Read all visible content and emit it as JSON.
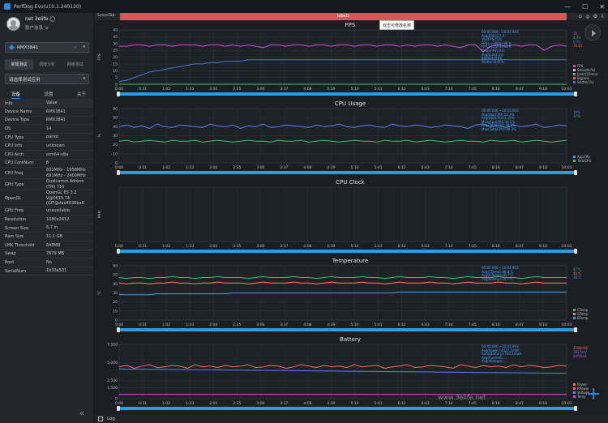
{
  "window": {
    "title": "PerfDog Evo(v10.1.240120)",
    "controls": [
      "—",
      "☐",
      "✕"
    ]
  },
  "user": {
    "name": "net 3elife ◯",
    "account": "账户信息 ⇲"
  },
  "device": {
    "name": "RMX3841",
    "wifi": "ᯤ",
    "dropdown": "▾"
  },
  "mode_tabs": [
    {
      "label": "常规测试",
      "active": true
    },
    {
      "label": "调度分析",
      "active": false
    },
    {
      "label": "网络测试",
      "active": false
    }
  ],
  "app_select": {
    "placeholder": "请选择测试应用",
    "dropdown": "▾"
  },
  "sub_tabs": [
    {
      "label": "设备",
      "active": true
    },
    {
      "label": "设置",
      "active": false
    },
    {
      "label": "关于",
      "active": false
    }
  ],
  "info_table": {
    "headers": [
      "Info",
      "Value"
    ],
    "rows": [
      [
        "Device Name",
        "RMX3841"
      ],
      [
        "Device Type",
        "RMX3841"
      ],
      [
        "OS",
        "14"
      ],
      [
        "CPU Type",
        "parrot"
      ],
      [
        "CPU Info",
        "unknown"
      ],
      [
        "CPU Arch",
        "arm64-v8a"
      ],
      [
        "CPU CoreNum",
        "8"
      ],
      [
        "CPU Freq",
        "691MHz - 1958MHz\n691MHz - 2400MHz"
      ],
      [
        "GPU Type",
        "Qualcomm Adreno\n(TM) 710"
      ],
      [
        "OpenGL",
        "OpenGL ES 3.2\nV@0615.74\n(GIT@dad4038ba6"
      ],
      [
        "GPU Freq",
        "unavailable"
      ],
      [
        "Resolution",
        "1080x2412"
      ],
      [
        "Screen Size",
        "6.7 in"
      ],
      [
        "Ram Size",
        "11.1 GB"
      ],
      [
        "LMK Threshold",
        "648MB"
      ],
      [
        "Swap",
        "7679 MB"
      ],
      [
        "Root",
        "No"
      ],
      [
        "SerialNum",
        "1b33e531"
      ]
    ]
  },
  "collapse_icon": "«",
  "topbar": {
    "scene_tab": "SceneTab",
    "label": "label1",
    "tooltip": "双击可修改名称",
    "icons": [
      "⊙",
      "◎",
      "⚙",
      "⇩"
    ]
  },
  "x_ticks": [
    "0:00",
    "0:31",
    "1:02",
    "1:33",
    "2:04",
    "2:35",
    "3:06",
    "3:37",
    "4:08",
    "4:39",
    "5:10",
    "5:41",
    "6:12",
    "6:43",
    "7:14",
    "7:45",
    "8:16",
    "8:47",
    "9:18",
    "10:03"
  ],
  "colors": {
    "fps": "#d14fd6",
    "fps_light": "#ff90ff",
    "jank": "#3fc46b",
    "jank_red": "#ff5a5a",
    "stutter": "#4a78c8",
    "appcpu": "#5f7df2",
    "totalcpu": "#3fc46b",
    "ctemp": "#3fc46b",
    "gtemp": "#ff7a59",
    "btemp": "#4a9be6",
    "power": "#ff6b5a",
    "voltage": "#5f7df2",
    "temp": "#d14fd6",
    "scroll": "#2a9de7",
    "grid": "#2e343b"
  },
  "chart_data": [
    {
      "type": "line",
      "title": "FPS",
      "ylabel": "FPS",
      "ylim": [
        0,
        40
      ],
      "yticks": [
        "0",
        "5",
        "10",
        "15",
        "20",
        "25",
        "30",
        "35",
        "40"
      ],
      "series": [
        {
          "name": "FPS",
          "values": [
            28,
            28,
            29,
            29,
            28,
            29,
            29,
            28,
            29,
            29,
            29,
            28,
            29,
            29,
            28,
            29,
            28,
            29,
            28,
            27,
            29,
            29,
            28,
            29,
            29,
            28,
            29,
            29,
            28,
            29,
            29,
            28,
            29,
            29,
            28,
            29,
            29,
            28,
            29,
            28,
            29,
            29,
            28,
            29,
            28,
            27,
            29,
            29,
            24,
            28,
            29,
            28,
            29,
            28,
            29,
            29,
            25,
            28,
            29,
            28
          ]
        },
        {
          "name": "Jank",
          "values": [
            0,
            0,
            0,
            0,
            0,
            0,
            0,
            0,
            0,
            0,
            0,
            0,
            0,
            0,
            0,
            0,
            0,
            0,
            0,
            0,
            0,
            0,
            0,
            0,
            0,
            0,
            0,
            0,
            0,
            0,
            0,
            0,
            0,
            0,
            0,
            0,
            0,
            0,
            0,
            0,
            0,
            0,
            0,
            0,
            0,
            0,
            0,
            0,
            0,
            0,
            0,
            0,
            0,
            0,
            0,
            0,
            0,
            0,
            0,
            0
          ]
        },
        {
          "name": "Stutter(%)",
          "values": [
            2,
            3,
            5,
            7,
            9,
            10,
            11,
            12,
            13,
            14,
            15,
            15,
            16,
            16,
            17,
            17,
            17,
            18,
            18,
            18,
            18,
            18,
            18,
            18,
            18,
            18,
            18,
            18,
            18,
            18,
            18,
            18,
            18,
            18,
            18,
            18,
            18,
            18,
            18,
            18,
            18,
            18,
            18,
            18,
            18,
            18,
            18,
            18,
            18,
            18,
            18,
            18,
            18,
            18,
            18,
            18,
            18,
            18,
            18,
            18
          ]
        }
      ],
      "legend": [
        "FPS",
        "Smooth(%)",
        "Jank(/10min)",
        "BigJank",
        "Stutter(%)"
      ],
      "right_values": [
        "30",
        "4.79",
        "0.00",
        "16.81"
      ],
      "info_box": "00:00:000 ~10:01:903\nAvg(FPS):27.2\nVar(FPS):5.0\nFPS>=18(%):98.9\nFPS>=25(%):91.9\nDrop(FPS):0.0\nAvg(Jank):4.8\nBigJank:0.00\nStutter:8.41%"
    },
    {
      "type": "line",
      "title": "CPU Usage",
      "ylabel": "%",
      "ylim": [
        0,
        60
      ],
      "yticks": [
        "0",
        "10",
        "20",
        "30",
        "40",
        "50",
        "60"
      ],
      "series": [
        {
          "name": "AppCPU",
          "values": [
            40,
            42,
            39,
            41,
            38,
            43,
            40,
            39,
            42,
            41,
            40,
            39,
            43,
            41,
            40,
            42,
            38,
            41,
            40,
            43,
            39,
            40,
            42,
            41,
            40,
            39,
            42,
            40,
            41,
            43,
            40,
            39,
            41,
            42,
            40,
            39,
            43,
            41,
            40,
            42,
            41,
            39,
            40,
            42,
            41,
            40,
            38,
            42,
            43,
            40,
            41,
            39,
            42,
            40,
            41,
            43,
            39,
            40,
            42,
            41
          ]
        },
        {
          "name": "TotalCPU",
          "values": [
            24,
            25,
            23,
            24,
            25,
            24,
            23,
            25,
            24,
            24,
            25,
            23,
            24,
            25,
            24,
            23,
            24,
            25,
            24,
            24,
            23,
            25,
            24,
            24,
            25,
            23,
            24,
            25,
            24,
            23,
            24,
            25,
            24,
            24,
            23,
            25,
            24,
            24,
            25,
            23,
            24,
            25,
            24,
            23,
            24,
            25,
            24,
            24,
            23,
            25,
            24,
            24,
            25,
            23,
            24,
            25,
            24,
            23,
            24,
            25
          ]
        }
      ],
      "legend": [
        "AppCPU",
        "TotalCPU"
      ],
      "right_values": [
        "19%",
        "37%"
      ],
      "info_box": "00:00:000 ~10:01:903\nAvg(AppCPU):22.3%\nAvg(AppCPU)/3.32%\nMax(AppCPU):34.5%\nAvg(TotalCPU):38.2%\nMax(TotalCPU):48.3%"
    },
    {
      "type": "line",
      "title": "CPU Clock",
      "ylabel": "MHz",
      "series": [],
      "legend": []
    },
    {
      "type": "line",
      "title": "Temperature",
      "ylabel": "°C",
      "ylim": [
        0,
        60
      ],
      "yticks": [
        "0",
        "10",
        "20",
        "30",
        "40",
        "50",
        "60"
      ],
      "series": [
        {
          "name": "CTemp",
          "values": [
            47,
            46,
            47,
            47,
            46,
            47,
            47,
            48,
            47,
            47,
            46,
            47,
            47,
            48,
            47,
            47,
            47,
            46,
            47,
            48,
            47,
            47,
            47,
            48,
            47,
            47,
            46,
            47,
            48,
            47,
            47,
            47,
            48,
            47,
            47,
            46,
            47,
            48,
            47,
            47,
            47,
            48,
            47,
            47,
            46,
            47,
            48,
            47,
            47,
            47,
            48,
            47,
            47,
            46,
            47,
            48,
            47,
            47,
            47,
            47
          ]
        },
        {
          "name": "GTemp",
          "values": [
            41,
            40,
            41,
            41,
            40,
            41,
            41,
            42,
            41,
            41,
            40,
            41,
            41,
            42,
            41,
            41,
            41,
            40,
            41,
            42,
            41,
            41,
            41,
            42,
            41,
            41,
            40,
            41,
            42,
            41,
            41,
            41,
            42,
            41,
            41,
            40,
            41,
            42,
            41,
            41,
            41,
            42,
            41,
            41,
            40,
            41,
            42,
            41,
            41,
            41,
            42,
            41,
            41,
            40,
            41,
            42,
            41,
            41,
            41,
            41
          ]
        },
        {
          "name": "BTemp",
          "values": [
            28,
            28,
            28,
            28,
            28,
            29,
            29,
            29,
            29,
            29,
            29,
            29,
            29,
            29,
            29,
            30,
            30,
            30,
            30,
            30,
            30,
            30,
            30,
            30,
            30,
            30,
            30,
            30,
            30,
            30,
            30,
            30,
            30,
            30,
            30,
            30,
            30,
            31,
            31,
            31,
            31,
            31,
            31,
            31,
            31,
            31,
            31,
            31,
            31,
            31,
            31,
            31,
            31,
            31,
            31,
            31,
            31,
            31,
            31,
            31
          ]
        }
      ],
      "legend": [
        "CTemp",
        "GTemp",
        "BTemp"
      ],
      "right_values": [
        "47°C",
        "40°C",
        "30°C"
      ],
      "info_box": "00:00:000 ~10:01:903\nAvg(CTemp):46.8°C\nAvg(GTemp):40.7°C\nAvg(BTemp):30.7°C"
    },
    {
      "type": "line",
      "title": "Battery",
      "ylabel": "",
      "ylim": [
        0,
        7500
      ],
      "yticks": [
        "0",
        "1,500",
        "2,500",
        "5,000",
        "7,500"
      ],
      "series": [
        {
          "name": "Power",
          "values": [
            4400,
            4600,
            4200,
            4500,
            4700,
            4300,
            4400,
            4600,
            4500,
            4200,
            4700,
            4400,
            4500,
            4300,
            4600,
            4400,
            4500,
            4700,
            4300,
            4400,
            4600,
            4500,
            4200,
            4400,
            4700,
            4500,
            4300,
            4600,
            4400,
            4500,
            4300,
            4700,
            4400,
            4500,
            4600,
            4200,
            4400,
            4500,
            4700,
            4300,
            4400,
            4600,
            4500,
            4400,
            4200,
            4700,
            4500,
            4300,
            4600,
            4400,
            4500,
            4300,
            4700,
            4400,
            4600,
            4500,
            4300,
            4400,
            4600,
            4500
          ]
        },
        {
          "name": "Voltage",
          "values": [
            4100,
            4090,
            4080,
            4070,
            4060,
            4050,
            4040,
            4030,
            4020,
            4010,
            4000,
            3990,
            3980,
            3970,
            3960,
            3950,
            3940,
            3930,
            3920,
            3910,
            3900,
            3890,
            3880,
            3870,
            3860,
            3850,
            3840,
            3830,
            3820,
            3810,
            3800,
            3790,
            3780,
            3770,
            3760,
            3750,
            3740,
            3730,
            3720,
            3710,
            3700,
            3690,
            3680,
            3670,
            3660,
            3650,
            3640,
            3630,
            3620,
            3610,
            3600,
            3590,
            3580,
            3570,
            3560,
            3550,
            3540,
            3530,
            3520,
            3510
          ]
        },
        {
          "name": "Temp",
          "values": [
            600,
            600,
            600,
            600,
            600,
            600,
            600,
            600,
            600,
            600,
            600,
            600,
            600,
            600,
            600,
            600,
            600,
            600,
            600,
            600,
            600,
            600,
            600,
            600,
            600,
            600,
            600,
            600,
            600,
            600,
            600,
            600,
            600,
            600,
            600,
            600,
            600,
            600,
            600,
            600,
            600,
            600,
            600,
            600,
            600,
            600,
            600,
            600,
            600,
            600,
            600,
            600,
            600,
            600,
            600,
            600,
            600,
            600,
            600,
            600
          ]
        }
      ],
      "legend": [
        "Power",
        "RPower",
        "Voltage",
        "Temp"
      ],
      "right_values": [
        "4180mW",
        "3817mV",
        "4490mA"
      ],
      "info_box": "00:00:000 ~10:01:903\nAvg(Power):4427.5mW\nSum(Battery):740.1mwh\nAvg(Current):...\nAvg(Voltage):..."
    }
  ],
  "bottom": {
    "log_label": "Log"
  },
  "watermark": "www.3elife.net"
}
